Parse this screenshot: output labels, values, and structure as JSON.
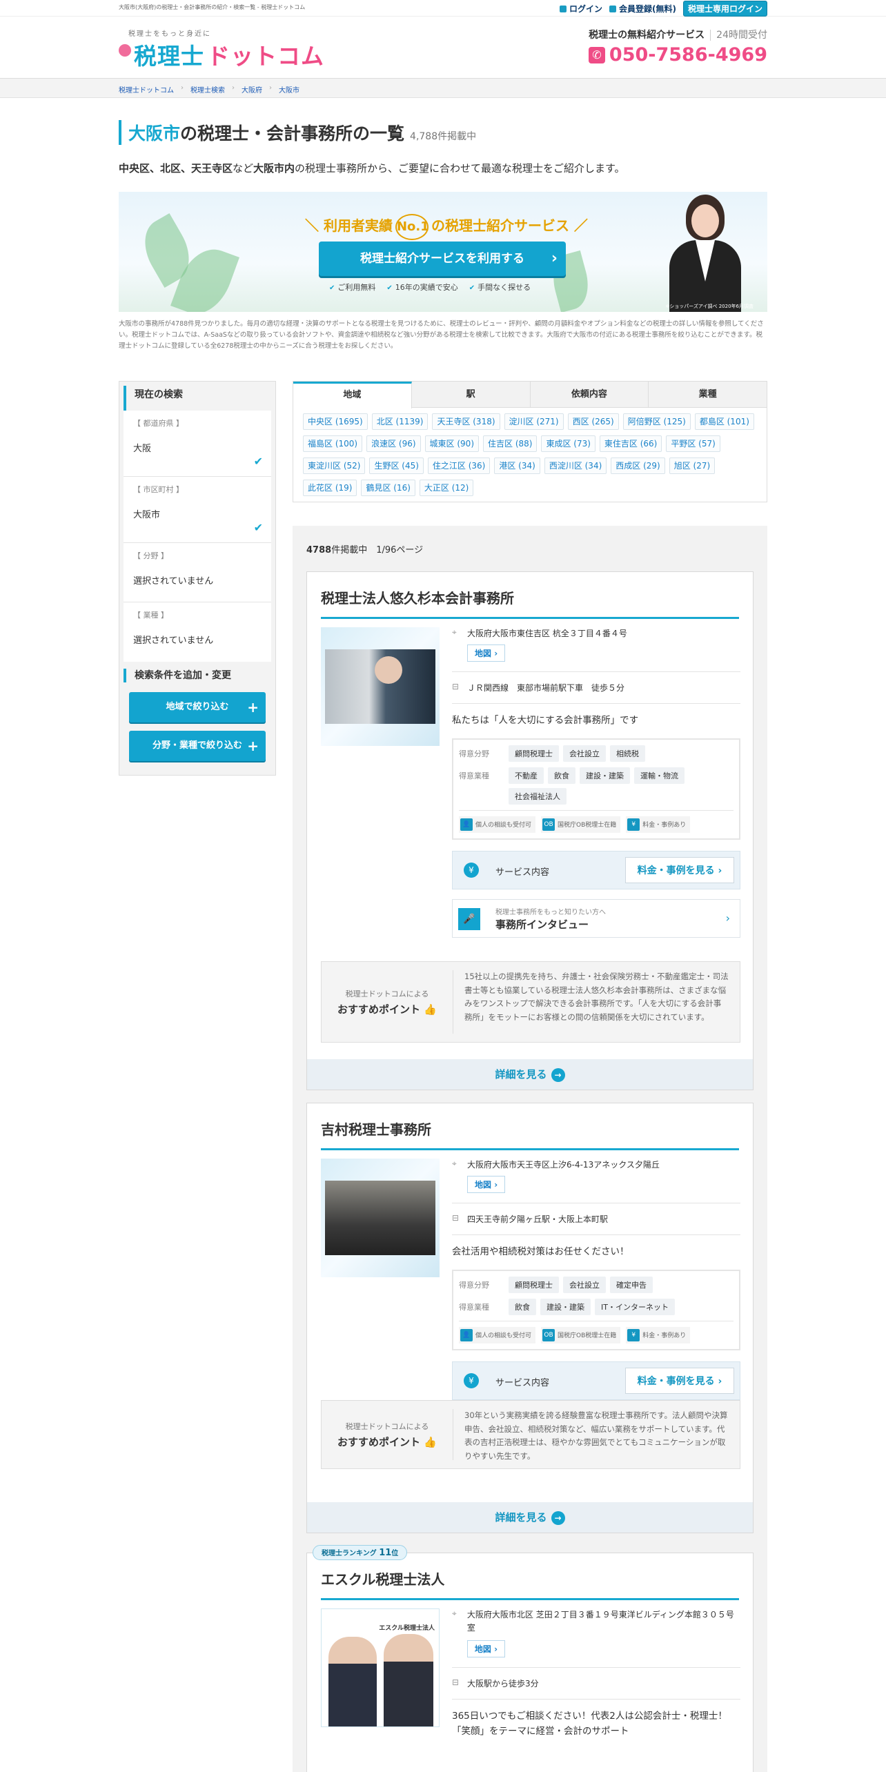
{
  "topbar": {
    "title": "大阪市(大阪府)の税理士・会計事務所の紹介・検索一覧 - 税理士ドットコム",
    "login": "ログイン",
    "register": "会員登録(無料)",
    "pro_login": "税理士専用ログイン"
  },
  "header": {
    "tagline": "税理士をもっと身近に",
    "logo_blue": "税理士",
    "logo_pink": "ドットコム",
    "service_label": "税理士の無料紹介サービス",
    "hours": "24時間受付",
    "phone": "050-7586-4969"
  },
  "breadcrumb": [
    "税理士ドットコム",
    "税理士検索",
    "大阪府",
    "大阪市"
  ],
  "page": {
    "title_city": "大阪市",
    "title_rest": "の税理士・会計事務所の一覧",
    "count": "4,788件掲載中",
    "intro_bold1": "中央区、北区、天王寺区",
    "intro_t1": "など",
    "intro_bold2": "大阪市内",
    "intro_t2": "の税理士事務所から、ご要望に合わせて最適な税理士をご紹介します。"
  },
  "banner": {
    "headline_pre": "＼ 利用者実績",
    "no1": "No.1",
    "headline_post": "の税理士紹介サービス ／",
    "button": "税理士紹介サービスを利用する",
    "points": [
      "ご利用無料",
      "16年の実績で安心",
      "手間なく探せる"
    ],
    "note": "※ショッパーズアイ調べ 2020年6月調査"
  },
  "description": "大阪市の事務所が4788件見つかりました。毎月の適切な経理・決算のサポートとなる税理士を見つけるために、税理士のレビュー・評判や、顧問の月額料金やオプション料金などの税理士の詳しい情報を参照してください。税理士ドットコムでは、A-SaaSなどの取り扱っている会計ソフトや、資金調達や相続税など強い分野がある税理士を検索して比較できます。大阪府で大阪市の付近にある税理士事務所を絞り込むことができます。税理士ドットコムに登録している全6278税理士の中からニーズに合う税理士をお探しください。",
  "sidebar": {
    "current_title": "現在の検索",
    "filters": [
      {
        "label": "【 都道府県 】",
        "value": "大阪",
        "checked": true
      },
      {
        "label": "【 市区町村 】",
        "value": "大阪市",
        "checked": true
      },
      {
        "label": "【 分野 】",
        "value": "選択されていません",
        "checked": false
      },
      {
        "label": "【 業種 】",
        "value": "選択されていません",
        "checked": false
      }
    ],
    "add_title": "検索条件を追加・変更",
    "btn_area": "地域で絞り込む",
    "btn_field": "分野・業種で絞り込む"
  },
  "tabs": [
    "地域",
    "駅",
    "依頼内容",
    "業種"
  ],
  "areas": [
    "中央区 (1695)",
    "北区 (1139)",
    "天王寺区 (318)",
    "淀川区 (271)",
    "西区 (265)",
    "阿倍野区 (125)",
    "都島区 (101)",
    "福島区 (100)",
    "浪速区 (96)",
    "城東区 (90)",
    "住吉区 (88)",
    "東成区 (73)",
    "東住吉区 (66)",
    "平野区 (57)",
    "東淀川区 (52)",
    "生野区 (45)",
    "住之江区 (36)",
    "港区 (34)",
    "西淀川区 (34)",
    "西成区 (29)",
    "旭区 (27)",
    "此花区 (19)",
    "鶴見区 (16)",
    "大正区 (12)"
  ],
  "results": {
    "count_bold": "4788",
    "count_rest": "件掲載中　1/96ページ"
  },
  "offices": [
    {
      "name": "税理士法人悠久杉本会計事務所",
      "address": "大阪府大阪市東住吉区 杭全３丁目４番４号",
      "map": "地図",
      "station": "ＪＲ関西線　東部市場前駅下車　徒歩５分",
      "catch": "私たちは「人を大切にする会計事務所」です",
      "fields_label": "得意分野",
      "fields": [
        "顧問税理士",
        "会社設立",
        "相続税"
      ],
      "industries_label": "得意業種",
      "industries": [
        "不動産",
        "飲食",
        "建設・建築",
        "運輸・物流",
        "社会福祉法人"
      ],
      "features": [
        "個人の相談も受付可",
        "国税庁OB税理士在籍",
        "料金・事例あり"
      ],
      "service_label": "サービス内容",
      "service_btn": "料金・事例を見る",
      "interview_sub": "税理士事務所をもっと知りたい方へ",
      "interview_title": "事務所インタビュー",
      "rec_label": "税理士ドットコムによる",
      "rec_title": "おすすめポイント",
      "rec_text": "15社以上の提携先を持ち、弁護士・社会保険労務士・不動産鑑定士・司法書士等とも協業している税理士法人悠久杉本会計事務所は、さまざまな悩みをワンストップで解決できる会計事務所です。「人を大切にする会計事務所」をモットーにお客様との間の信頼関係を大切にされています。",
      "more": "詳細を見る"
    },
    {
      "name": "吉村税理士事務所",
      "address": "大阪府大阪市天王寺区上汐6-4-13アネックス夕陽丘",
      "map": "地図",
      "station": "四天王寺前夕陽ヶ丘駅・大阪上本町駅",
      "catch": "会社活用や相続税対策はお任せください！",
      "fields_label": "得意分野",
      "fields": [
        "顧問税理士",
        "会社設立",
        "確定申告"
      ],
      "industries_label": "得意業種",
      "industries": [
        "飲食",
        "建設・建築",
        "IT・インターネット"
      ],
      "features": [
        "個人の相談も受付可",
        "国税庁OB税理士在籍",
        "料金・事例あり"
      ],
      "service_label": "サービス内容",
      "service_btn": "料金・事例を見る",
      "rec_label": "税理士ドットコムによる",
      "rec_title": "おすすめポイント",
      "rec_text": "30年という実務実績を誇る経験豊富な税理士事務所です。法人顧問や決算申告、会社設立、相続税対策など、幅広い業務をサポートしています。代表の吉村正浩税理士は、穏やかな雰囲気でとてもコミュニケーションが取りやすい先生です。",
      "more": "詳細を見る"
    },
    {
      "rank_pre": "税理士ランキング",
      "rank": "11",
      "rank_post": "位",
      "name": "エスクル税理士法人",
      "img_label": "エスクル税理士法人",
      "address": "大阪府大阪市北区 芝田２丁目３番１９号東洋ビルディング本館３０５号室",
      "map": "地図",
      "station": "大阪駅から徒歩3分",
      "catch": "365日いつでもご相談ください！代表2人は公認会計士・税理士！「笑顔」をテーマに経営・会計のサポート"
    }
  ],
  "colors": {
    "accent": "#17a8d0",
    "pink": "#ef4c86",
    "link": "#1b83c9"
  }
}
